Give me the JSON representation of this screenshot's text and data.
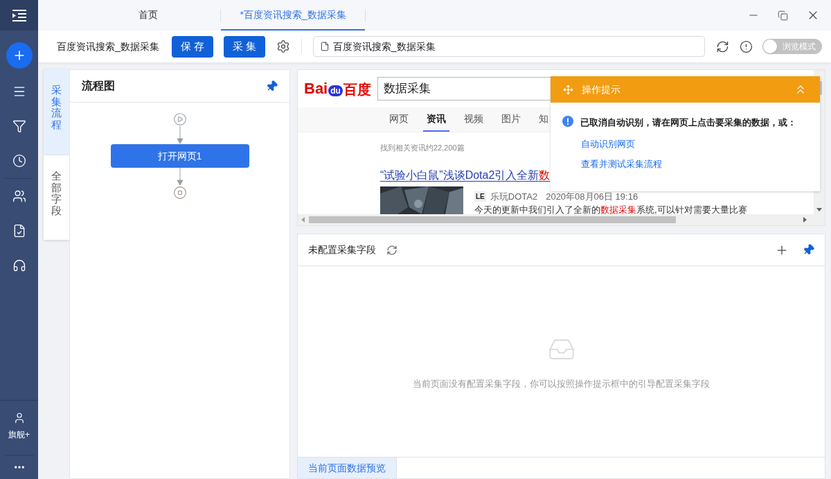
{
  "sidebar": {
    "account_label": "旗舰+"
  },
  "tabs": [
    {
      "label": "首页",
      "selected": false
    },
    {
      "label": "*百度资讯搜索_数据采集",
      "selected": true
    }
  ],
  "toolbar": {
    "task_name": "百度资讯搜索_数据采集",
    "buttons": [
      "保 存",
      "采 集"
    ],
    "url": "百度资讯搜索_数据采集",
    "browse_mode": {
      "label": "浏览模式",
      "on": false
    }
  },
  "side_tabs": [
    {
      "label": "采集流程",
      "selected": true
    },
    {
      "label": "全部字段",
      "selected": false
    }
  ],
  "flow": {
    "title": "流程图",
    "steps": [
      "打开网页1"
    ]
  },
  "browser": {
    "logo": {
      "left": "Bai",
      "paw": "du",
      "right": "百度"
    },
    "search_query": "数据采集",
    "nav_tabs": [
      {
        "label": "网页",
        "selected": false
      },
      {
        "label": "资讯",
        "selected": true
      },
      {
        "label": "视频",
        "selected": false
      },
      {
        "label": "图片",
        "selected": false
      },
      {
        "label": "知",
        "selected": false
      }
    ],
    "result_count": "找到相关资讯约22,200篇",
    "results": [
      {
        "title": [
          {
            "text": "“试验小白鼠”浅谈Dota2引入全新",
            "highlight": false
          },
          {
            "text": "数",
            "highlight": true
          }
        ],
        "source_badge": "LE",
        "source": "乐玩DOTA2",
        "date": "2020年08月06日 19:16",
        "snippet": [
          {
            "text": "今天的更新中我们引入了全新的",
            "highlight": false
          },
          {
            "text": "数据采集",
            "highlight": true
          },
          {
            "text": "系统,可以针对需要大量比赛",
            "highlight": false
          }
        ]
      }
    ]
  },
  "tip_popup": {
    "title": "操作提示",
    "message": "已取消自动识别，请在网页上点击要采集的数据，或：",
    "links": [
      "自动识别网页",
      "查看并测试采集流程"
    ]
  },
  "fields_panel": {
    "title": "未配置采集字段",
    "empty_message": "当前页面没有配置采集字段，你可以按照操作提示框中的引导配置采集字段"
  },
  "bottom_tabs": [
    {
      "label": "当前页面数据预览",
      "selected": true
    }
  ]
}
